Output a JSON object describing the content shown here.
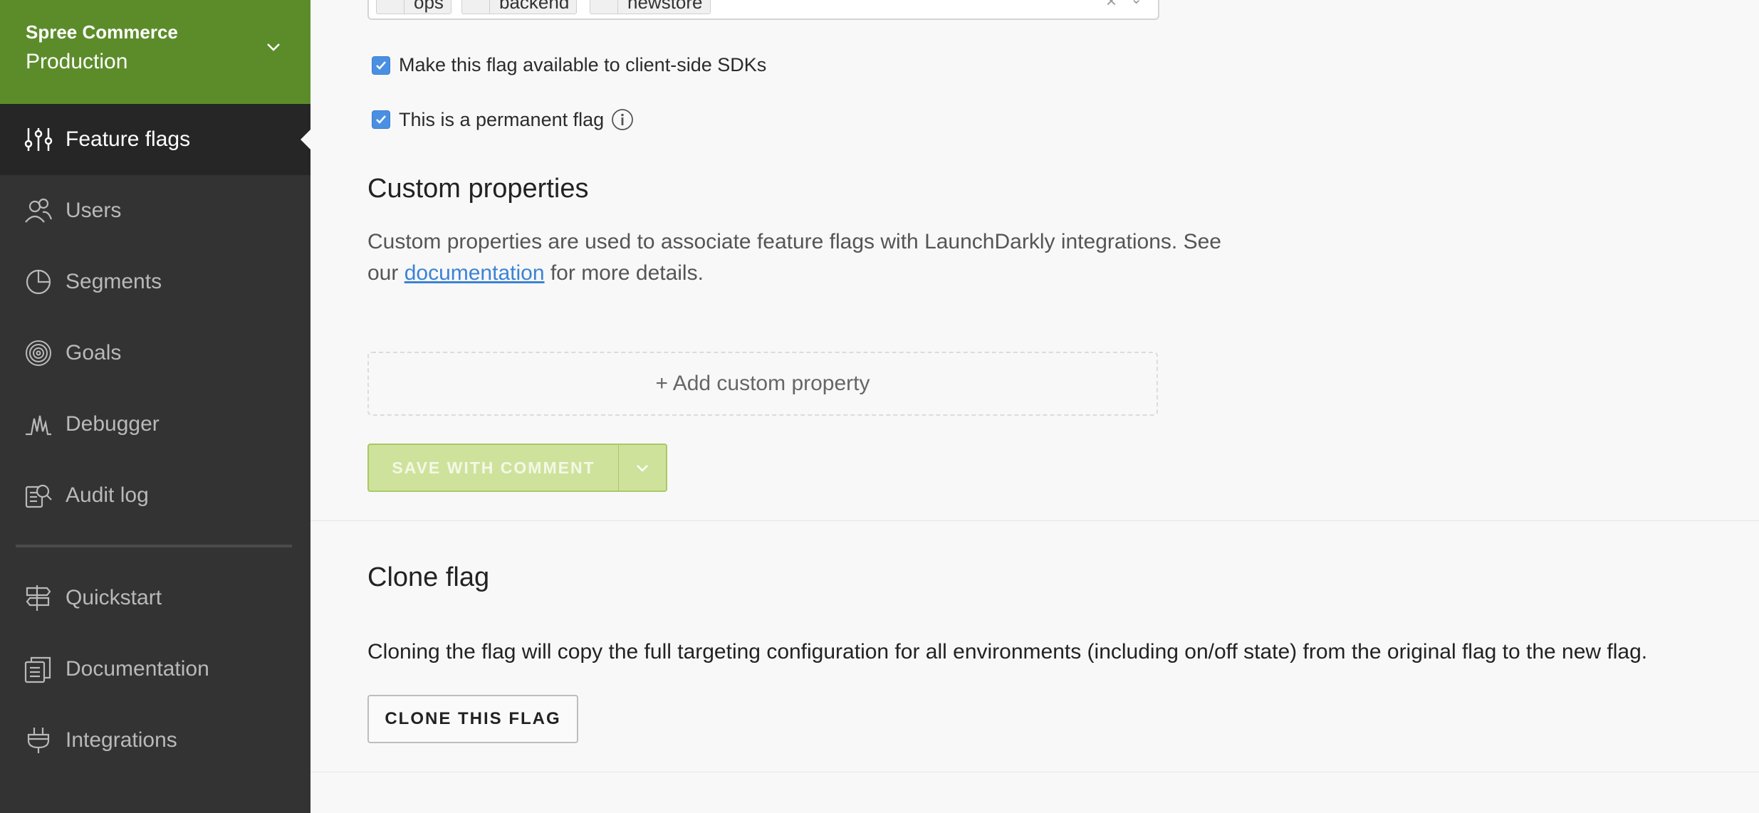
{
  "sidebar": {
    "project": "Spree Commerce",
    "environment": "Production",
    "items": [
      {
        "label": "Feature flags",
        "icon": "sliders-icon",
        "active": true
      },
      {
        "label": "Users",
        "icon": "users-icon"
      },
      {
        "label": "Segments",
        "icon": "pie-chart-icon"
      },
      {
        "label": "Goals",
        "icon": "target-icon"
      },
      {
        "label": "Debugger",
        "icon": "pulse-icon"
      },
      {
        "label": "Audit log",
        "icon": "audit-log-icon"
      },
      {
        "label": "Quickstart",
        "icon": "signpost-icon"
      },
      {
        "label": "Documentation",
        "icon": "book-icon"
      },
      {
        "label": "Integrations",
        "icon": "plug-icon"
      }
    ]
  },
  "tags": {
    "items": [
      "ops",
      "backend",
      "newstore"
    ],
    "clear": "×",
    "caret": "⌄"
  },
  "options": {
    "client_side": "Make this flag available to client-side SDKs",
    "permanent": "This is a permanent flag"
  },
  "custom_properties": {
    "title": "Custom properties",
    "desc_before": "Custom properties are used to associate feature flags with LaunchDarkly integrations. See our ",
    "link": "documentation",
    "desc_after": " for more details.",
    "add_label": "+ Add custom property"
  },
  "save": {
    "label": "SAVE WITH COMMENT"
  },
  "clone": {
    "title": "Clone flag",
    "description": "Cloning the flag will copy the full targeting configuration for all environments (including on/off state) from the original flag to the new flag.",
    "button": "CLONE THIS FLAG"
  },
  "colors": {
    "env_header": "#5c8c2a",
    "sidebar": "#333333",
    "save_button": "#cfe29c",
    "link": "#3b83d4"
  }
}
